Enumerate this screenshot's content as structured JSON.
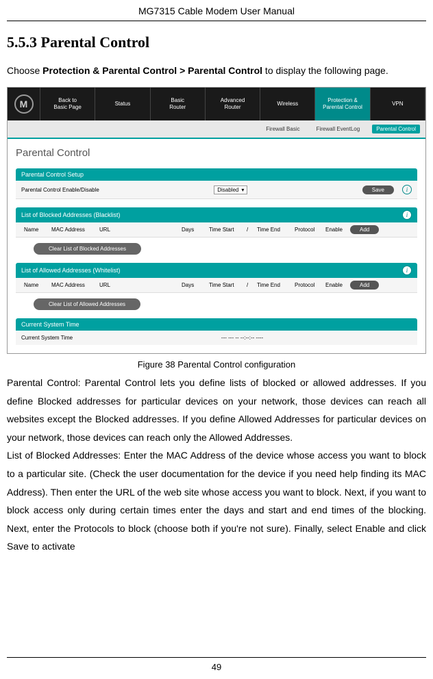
{
  "header": "MG7315 Cable Modem User Manual",
  "section_number": "5.5.3",
  "section_title": "Parental Control",
  "intro_prefix": "Choose ",
  "intro_bold": "Protection & Parental Control > Parental Control",
  "intro_suffix": " to display the following page.",
  "nav": {
    "items": [
      "Back to\nBasic Page",
      "Status",
      "Basic\nRouter",
      "Advanced\nRouter",
      "Wireless",
      "Protection &\nParental Control",
      "VPN"
    ],
    "active_index": 5
  },
  "subnav": {
    "items": [
      "Firewall Basic",
      "Firewall EventLog",
      "Parental Control"
    ],
    "active_index": 2
  },
  "page_heading": "Parental Control",
  "setup": {
    "bar": "Parental Control Setup",
    "label": "Parental Control Enable/Disable",
    "dropdown_value": "Disabled",
    "save": "Save"
  },
  "blacklist": {
    "bar": "List of Blocked Addresses (Blacklist)",
    "headers": [
      "Name",
      "MAC Address",
      "URL",
      "Days",
      "Time Start",
      "/",
      "Time End",
      "Protocol",
      "Enable"
    ],
    "add": "Add",
    "clear": "Clear List of Blocked Addresses"
  },
  "whitelist": {
    "bar": "List of Allowed Addresses (Whitelist)",
    "headers": [
      "Name",
      "MAC Address",
      "URL",
      "Days",
      "Time Start",
      "/",
      "Time End",
      "Protocol",
      "Enable"
    ],
    "add": "Add",
    "clear": "Clear List of Allowed Addresses"
  },
  "systime": {
    "bar": "Current System Time",
    "label": "Current System Time",
    "value": "--- --- -- --:--:-- ----"
  },
  "caption": "Figure 38 Parental Control configuration",
  "para1": "Parental Control: Parental Control lets you define lists of blocked or allowed addresses. If you define Blocked addresses for particular devices on your network, those devices can reach all websites except the Blocked addresses. If you define Allowed Addresses for particular devices on your network, those devices can reach only the Allowed Addresses.",
  "para2": "List of Blocked Addresses: Enter the MAC Address of the device whose access you want to block to a particular site. (Check the user documentation for the device if you need help finding its MAC Address). Then enter the URL of the web site whose access you want to block. Next, if you want to block access only during certain times enter the days and start and end times of the blocking. Next, enter the Protocols to block (choose both if you're not sure). Finally, select Enable and click Save to activate",
  "page_number": "49"
}
